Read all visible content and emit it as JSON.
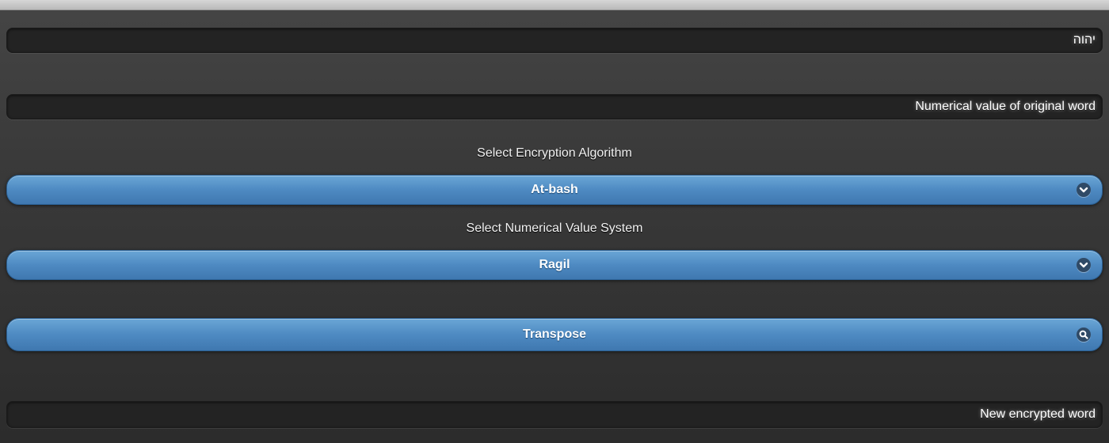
{
  "word_input": {
    "value": "יהוה"
  },
  "original_value_field": {
    "placeholder": "Numerical value of original word"
  },
  "encryption": {
    "label": "Select Encryption Algorithm",
    "selected": "At-bash"
  },
  "value_system": {
    "label": "Select Numerical Value System",
    "selected": "Ragil"
  },
  "transpose_button": {
    "label": "Transpose"
  },
  "result_field": {
    "placeholder": "New encrypted word"
  },
  "colors": {
    "button_blue": "#4e8ac2",
    "field_bg": "#232323",
    "page_bg": "#3a3a3a"
  },
  "icons": {
    "dropdown": "chevron-down-icon",
    "search": "search-icon"
  }
}
